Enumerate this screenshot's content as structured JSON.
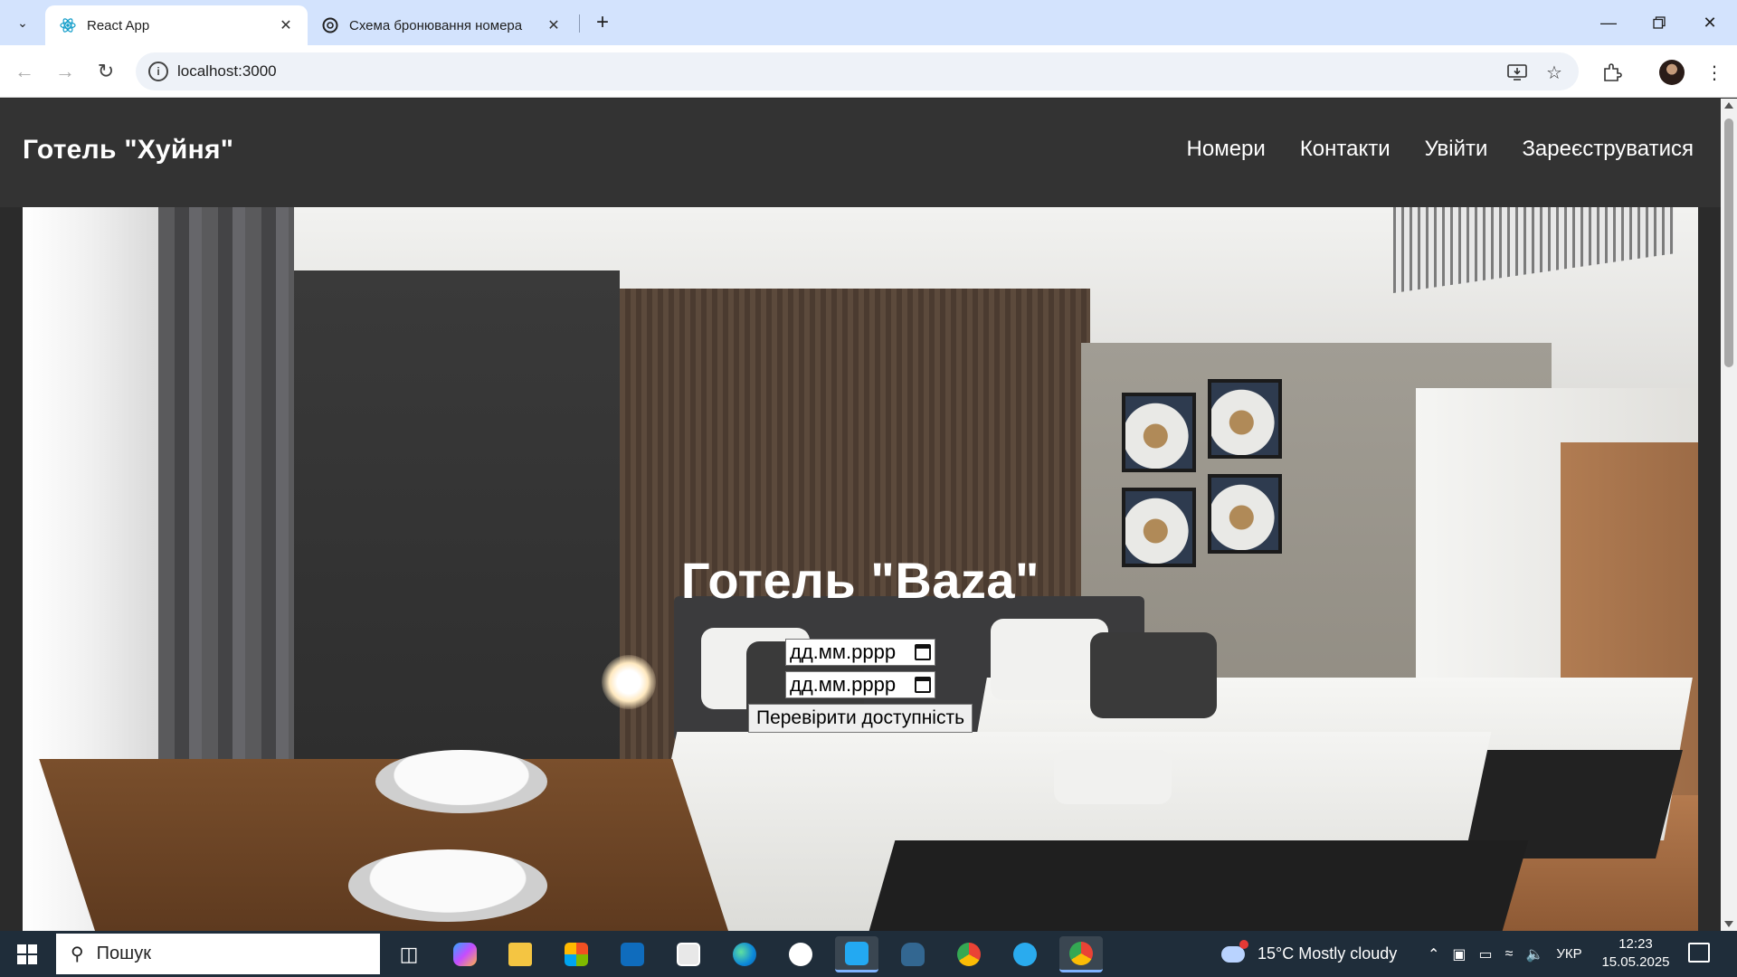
{
  "browser": {
    "tabs": [
      {
        "title": "React App",
        "active": true
      },
      {
        "title": "Схема бронювання номера",
        "active": false
      }
    ],
    "address": "localhost:3000"
  },
  "site": {
    "logo": "Готель \"Хуйня\"",
    "nav": [
      "Номери",
      "Контакти",
      "Увійти",
      "Зареєструватися"
    ],
    "hero_title": "Готель \"Baza\"",
    "checkin_placeholder": "дд.мм.рррр",
    "checkout_placeholder": "дд.мм.рррр",
    "check_button": "Перевірити доступність"
  },
  "taskbar": {
    "search_placeholder": "Пошук",
    "weather": "15°C  Mostly cloudy",
    "language": "УКР",
    "time": "12:23",
    "date": "15.05.2025"
  },
  "colors": {
    "tabstrip": "#d3e3fd",
    "site_header": "#333333",
    "taskbar": "#1f2d3a"
  }
}
